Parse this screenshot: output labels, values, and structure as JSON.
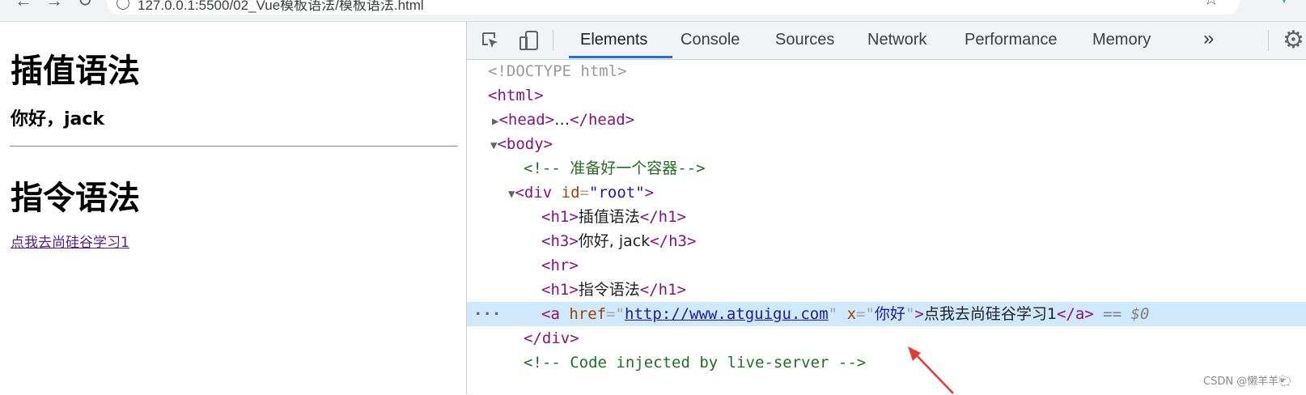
{
  "browser": {
    "url": "127.0.0.1:5500/02_Vue模板语法/模板语法.html"
  },
  "page": {
    "h1_interpolation": "插值语法",
    "h3_greeting": "你好，jack",
    "h1_directive": "指令语法",
    "link_text": "点我去尚硅谷学习1"
  },
  "devtools": {
    "tabs": [
      "Elements",
      "Console",
      "Sources",
      "Network",
      "Performance",
      "Memory"
    ],
    "active_tab": "Elements",
    "more_tabs": "»",
    "accent_color": "#1a73e8",
    "dom": {
      "doctype": "<!DOCTYPE html>",
      "html_open": "<html>",
      "head_open": "<head>",
      "head_ellipsis": "…",
      "head_close": "</head>",
      "body_open": "<body>",
      "comment_container": "<!-- 准备好一个容器-->",
      "div_open_start": "<div",
      "attr_id": "id",
      "attr_id_value": "\"root\"",
      "tag_end": ">",
      "h1_open": "<h1>",
      "h1_close": "</h1>",
      "h1_text": "插值语法",
      "h3_open": "<h3>",
      "h3_close": "</h3>",
      "h3_text": "你好, jack",
      "hr": "<hr>",
      "h1b_text": "指令语法",
      "a_open_start": "<a",
      "attr_href": "href",
      "href_value": "http://www.atguigu.com",
      "attr_x": "x",
      "x_value": "你好",
      "a_text": "点我去尚硅谷学习1",
      "a_close": "</a>",
      "selected_marker": "== $0",
      "div_close": "</div>",
      "comment_live_server": "<!-- Code injected by live-server -->"
    }
  },
  "watermark": "CSDN @懒羊羊🐑"
}
